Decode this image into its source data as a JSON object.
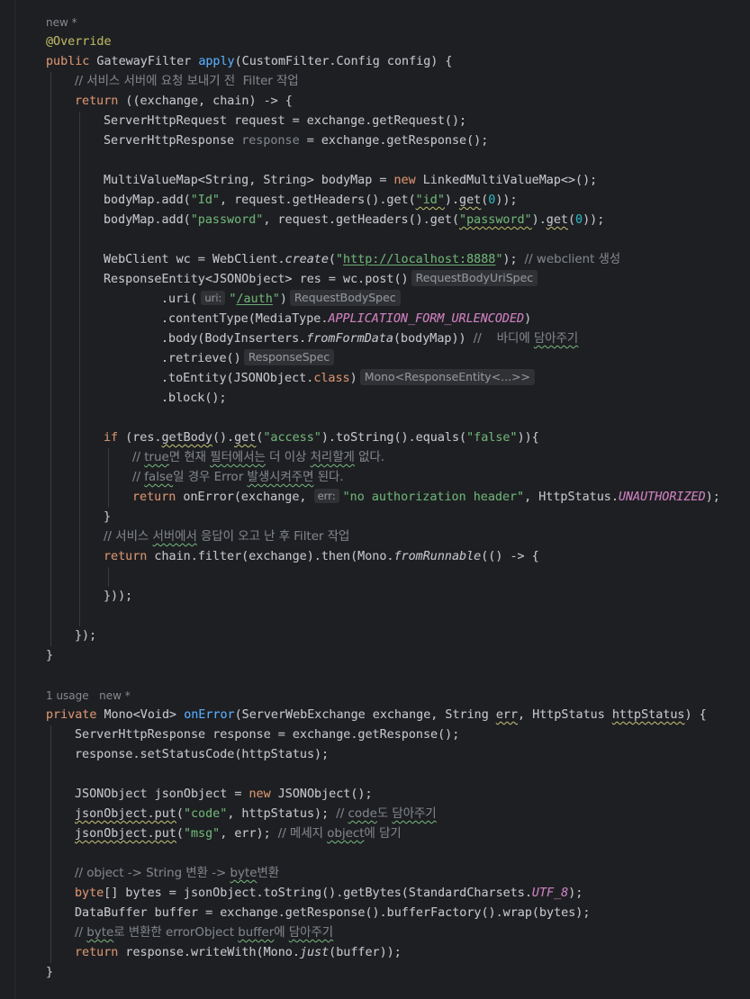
{
  "editor": {
    "method1_meta": "new *",
    "method2_meta_usage": "1 usage",
    "method2_meta_new": "new *",
    "lines": {
      "override": "@Override",
      "sig1_kw": "public",
      "sig1_type": " GatewayFilter ",
      "sig1_name": "apply",
      "sig1_rest": "(CustomFilter.Config config) {",
      "c1": "// 서비스 서버에 요청 보내기 전  Filter 작업",
      "ret1_kw": "return",
      "ret1_rest": " ((exchange, chain) -> {",
      "req": "ServerHttpRequest request = exchange.getRequest();",
      "resp_a": "ServerHttpResponse ",
      "resp_var": "response",
      "resp_b": " = exchange.getResponse();",
      "map_a": "MultiValueMap<String, String> bodyMap = ",
      "map_new": "new",
      "map_b": " LinkedMultiValueMap<>();",
      "add1_a": "bodyMap.add(",
      "add1_s1": "\"Id\"",
      "add1_b": ", request.getHeaders().get(",
      "add1_s2": "\"id\"",
      "add1_c": ").",
      "add1_get": "get",
      "add1_d": "(",
      "add1_n": "0",
      "add1_e": "));",
      "add2_a": "bodyMap.add(",
      "add2_s1": "\"password\"",
      "add2_b": ", request.getHeaders().get(",
      "add2_s2": "\"password\"",
      "add2_c": ").",
      "add2_get": "get",
      "add2_d": "(",
      "add2_n": "0",
      "add2_e": "));",
      "wc_a": "WebClient wc = WebClient.",
      "wc_create": "create",
      "wc_b": "(",
      "wc_q1": "\"",
      "wc_url": "http://localhost:8888",
      "wc_q2": "\"",
      "wc_c": "); ",
      "wc_cm": "// webclient 생성",
      "res_a": "ResponseEntity<JSONObject> res = wc.post()",
      "res_hint": "RequestBodyUriSpec",
      "uri_a": ".uri(",
      "uri_phint": "uri:",
      "uri_q1": "\"",
      "uri_s": "/auth",
      "uri_q2": "\"",
      "uri_b": ")",
      "uri_hint": "RequestBodySpec",
      "ct_a": ".contentType(MediaType.",
      "ct_const": "APPLICATION_FORM_URLENCODED",
      "ct_b": ")",
      "body_a": ".body(BodyInserters.",
      "body_it": "fromFormData",
      "body_b": "(bodyMap)) ",
      "body_cm1": "//    바디에 ",
      "body_cm2": "담아주기",
      "retr_a": ".retrieve()",
      "retr_hint": "ResponseSpec",
      "ent_a": ".toEntity(JSONObject.",
      "ent_cls": "class",
      "ent_b": ")",
      "ent_hint": "Mono<ResponseEntity<...>>",
      "block": ".block();",
      "if_kw": "if",
      "if_a": " (res.",
      "if_getBody": "getBody",
      "if_b": "().",
      "if_get": "get",
      "if_c": "(",
      "if_s1": "\"access\"",
      "if_d": ").toString().equals(",
      "if_s2": "\"false\"",
      "if_e": ")){",
      "c2_a": "// ",
      "c2_w": "true",
      "c2_b": "면 현재 ",
      "c2_w2": "필터에서는",
      "c2_c": " 더 이상 ",
      "c2_w3": "처리할게",
      "c2_d": " 없다.",
      "c3_a": "// ",
      "c3_w": "false",
      "c3_b": "일 경우 Error ",
      "c3_w2": "발생시켜주면",
      "c3_c": " 된다.",
      "ret2_kw": "return",
      "ret2_a": " onError(exchange, ",
      "ret2_phint": "err:",
      "ret2_s": "\"no authorization header\"",
      "ret2_b": ", HttpStatus.",
      "ret2_const": "UNAUTHORIZED",
      "ret2_c": ");",
      "close_if": "}",
      "c4_a": "// 서비스 ",
      "c4_w": "서버에서",
      "c4_b": " 응답이 오고 난 후 Filter 작업",
      "ret3_kw": "return",
      "ret3_a": " chain.filter(exchange).then(Mono.",
      "ret3_it": "fromRunnable",
      "ret3_b": "(() -> {",
      "close_lambda": "}));",
      "close_outer": "});",
      "close_method": "}",
      "sig2_kw": "private",
      "sig2_type": " Mono<Void> ",
      "sig2_name": "onError",
      "sig2_a": "(ServerWebExchange exchange, String ",
      "sig2_err": "err",
      "sig2_b": ", HttpStatus ",
      "sig2_hs": "httpStatus",
      "sig2_c": ") {",
      "m2_resp": "ServerHttpResponse response = exchange.getResponse();",
      "m2_status": "response.setStatusCode(httpStatus);",
      "m2_json_a": "JSONObject jsonObject = ",
      "m2_json_new": "new",
      "m2_json_b": " JSONObject();",
      "put1_w": "jsonObject.put",
      "put1_a": "(",
      "put1_s": "\"code\"",
      "put1_b": ", httpStatus); ",
      "put1_cm1": "// ",
      "put1_cm_w": "code",
      "put1_cm2": "도 ",
      "put1_cm_w2": "담아주기",
      "put2_w": "jsonObject.put",
      "put2_a": "(",
      "put2_s": "\"msg\"",
      "put2_b": ", err); ",
      "put2_cm1": "// 메세지 ",
      "put2_cm_w": "object",
      "put2_cm2": "에 담기",
      "c5_a": "// object -> String 변환 -> ",
      "c5_w": "byte",
      "c5_b": "변환",
      "bytes_kw": "byte",
      "bytes_a": "[] bytes = jsonObject.toString().getBytes(StandardCharsets.",
      "bytes_const": "UTF_8",
      "bytes_b": ");",
      "buf": "DataBuffer buffer = exchange.getResponse().bufferFactory().wrap(bytes);",
      "c6_a": "// ",
      "c6_w": "byte",
      "c6_b": "로 변환한 errorObject ",
      "c6_w2": "buffer",
      "c6_c": "에 ",
      "c6_w3": "담아주기",
      "ret4_kw": "return",
      "ret4_a": " response.writeWith(Mono.",
      "ret4_it": "just",
      "ret4_b": "(buffer));",
      "close_m2": "}"
    }
  }
}
